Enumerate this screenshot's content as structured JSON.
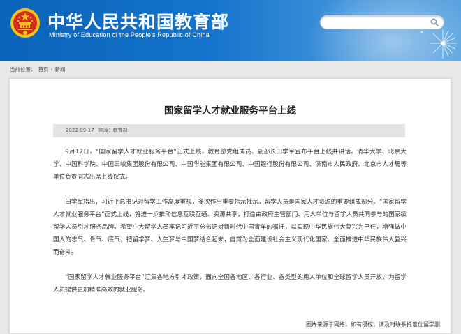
{
  "header": {
    "site_title": "中华人民共和国教育部",
    "site_subtitle": "Ministry of Education of the People's Republic of China",
    "search_placeholder": ""
  },
  "breadcrumb": {
    "label": "当前位置：",
    "items": [
      "首页",
      "新闻"
    ],
    "separator": "›"
  },
  "article": {
    "title": "国家留学人才就业服务平台上线",
    "date": "2022-09-17",
    "source_label": "来源：",
    "source": "教育部",
    "paragraphs": [
      "9月17日，“国家留学人才就业服务平台”正式上线。教育部党组成员、副部长田学军宣布平台上线并讲话。清华大学、北京大学、中国科学院、中国三峡集团股份有限公司、中国华能集团有限公司、中国银行股份有限公司、济南市人民政府、北京市人才局等单位负责同志出席上线仪式。",
      "田学军指出，习近平总书记对留学工作高度重视，多次作出重要指示批示。留学人员是国家人才资源的重要组成部分。“国家留学人才就业服务平台”正式上线，将进一步推动信息互联互通、资源共享，打造由政府主管部门、用人单位与留学人员共同参与的国家级留学人员引才服务品牌。希望广大留学人员牢记习近平总书记对新时代中国青年的嘱托，以实现中华民族伟大复兴为己任，增强做中国人的志气、骨气、底气，把留学梦、人生梦与中国梦结合起来，自觉为全面建设社会主义现代化国家、全面推进中华民族伟大复兴而奋斗。",
      "“国家留学人才就业服务平台”汇集各地方引才政策，面向全国各地区、各行业、各类型的用人单位和全球留学人员开放，为留学人员提供更加精准高效的就业服务。"
    ]
  },
  "image_note": "图片来源于网络，如有侵权，请及时联系托普仕留学删",
  "colors": {
    "header_blue": "#0a63b8",
    "emblem_red": "#d42a20",
    "emblem_gold": "#f3c318",
    "meta_bar_bg": "#e4e4e4"
  },
  "icons": [
    "national-emblem-icon",
    "search-icon",
    "dandelion-decoration"
  ]
}
